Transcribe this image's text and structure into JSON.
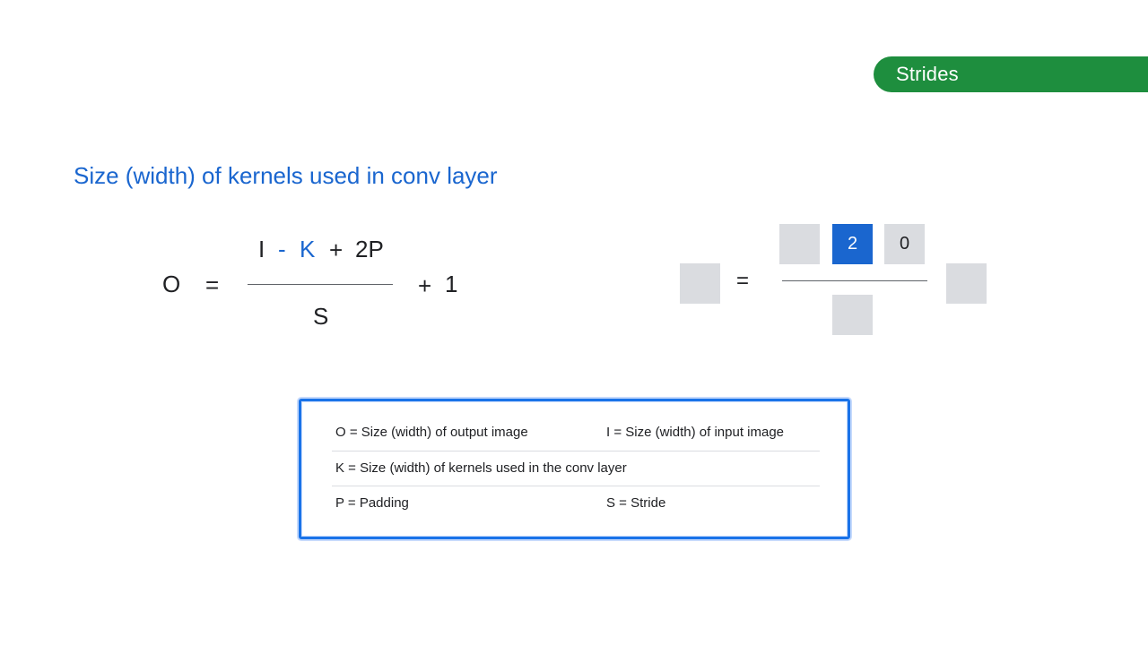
{
  "tag": {
    "label": "Strides",
    "color": "#1e8e3e"
  },
  "heading": {
    "text": "Size (width) of kernels used in conv layer",
    "color": "#1a66cf"
  },
  "formula": {
    "output": "O",
    "equals": "=",
    "input": "I",
    "minus": "-",
    "kernel": "K",
    "plus": "+",
    "padding_term": "2P",
    "stride": "S",
    "plus_one_sign": "+",
    "one": "1"
  },
  "right_formula": {
    "equals": "=",
    "numerator_values": [
      "",
      "2",
      "0"
    ],
    "active_index": 1,
    "active_color": "#1a66cf",
    "placeholder_color": "#dadce0"
  },
  "legend": {
    "rows": [
      {
        "left": "O = Size (width) of output image",
        "right": "I = Size (width) of input image"
      },
      {
        "left": "K = Size (width) of kernels used in the conv layer",
        "right": ""
      },
      {
        "left": "P = Padding",
        "right": "S = Stride"
      }
    ],
    "border_color": "#1a73e8"
  }
}
